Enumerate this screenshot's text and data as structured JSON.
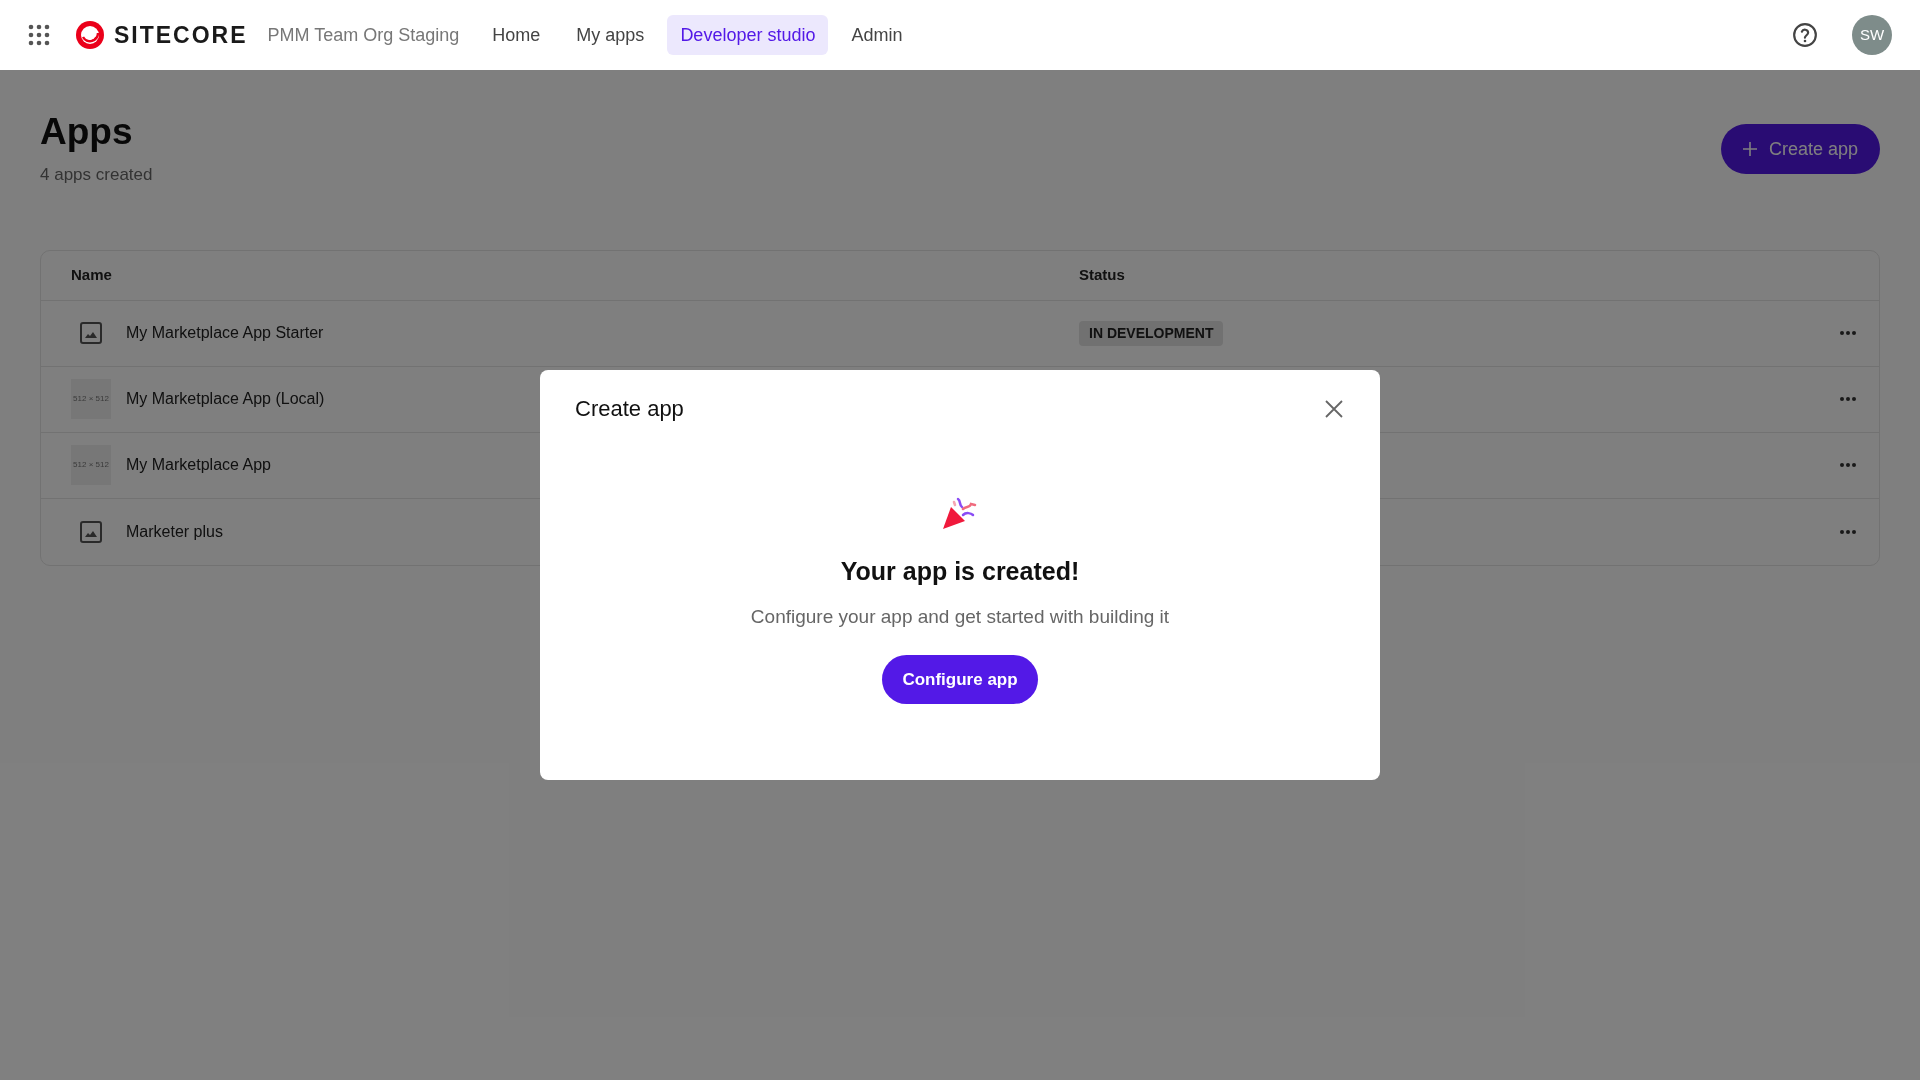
{
  "nav": {
    "brand": "SITECORE",
    "org": "PMM Team Org Staging",
    "tabs": [
      {
        "label": "Home",
        "selected": false
      },
      {
        "label": "My apps",
        "selected": false
      },
      {
        "label": "Developer studio",
        "selected": true
      },
      {
        "label": "Admin",
        "selected": false
      }
    ],
    "avatar": "SW"
  },
  "page": {
    "title": "Apps",
    "subtitle": "4 apps created",
    "create_button": "Create app"
  },
  "table": {
    "columns": [
      "Name",
      "Status"
    ],
    "rows": [
      {
        "name": "My Marketplace App Starter",
        "thumbnail": {
          "kind": "icon"
        },
        "status": "IN DEVELOPMENT"
      },
      {
        "name": "My Marketplace App (Local)",
        "thumbnail": {
          "kind": "placeholder",
          "label": "512 × 512"
        }
      },
      {
        "name": "My Marketplace App",
        "thumbnail": {
          "kind": "placeholder",
          "label": "512 × 512"
        }
      },
      {
        "name": "Marketer plus",
        "thumbnail": {
          "kind": "icon"
        }
      }
    ]
  },
  "modal": {
    "title": "Create app",
    "heading": "Your app is created!",
    "message": "Configure your app and get started with building it",
    "button": "Configure app"
  }
}
